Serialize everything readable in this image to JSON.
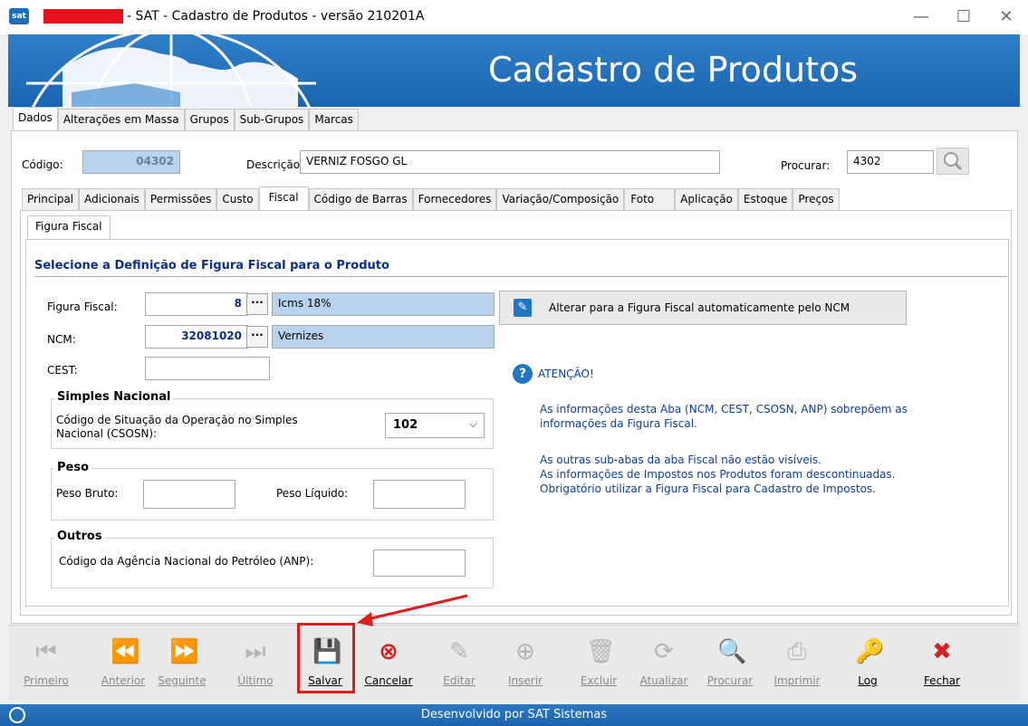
{
  "window": {
    "title": "- SAT - Cadastro de Produtos - versão 210201A",
    "app_icon": "sat",
    "minimize": "—",
    "maximize": "☐",
    "close": "✕"
  },
  "banner": {
    "title": "Cadastro de Produtos"
  },
  "main_tabs": [
    "Dados",
    "Alterações em Massa",
    "Grupos",
    "Sub-Grupos",
    "Marcas"
  ],
  "product": {
    "codigo_label": "Código:",
    "codigo_value": "04302",
    "descricao_label": "Descrição:",
    "descricao_value": "VERNIZ FOSGO GL",
    "procurar_label": "Procurar:",
    "procurar_value": "4302"
  },
  "sub_tabs": [
    "Principal",
    "Adicionais",
    "Permissões",
    "Custo",
    "Fiscal",
    "Código de Barras",
    "Fornecedores",
    "Variação/Composição",
    "Foto",
    "Aplicação",
    "Estoque",
    "Preços"
  ],
  "inner_tabs": [
    "Figura Fiscal"
  ],
  "fiscal": {
    "section_title": "Selecione a Definição de Figura Fiscal para o Produto",
    "figura_label": "Figura Fiscal:",
    "figura_code": "8",
    "figura_desc": "Icms 18%",
    "ncm_label": "NCM:",
    "ncm_code": "32081020",
    "ncm_desc": "Vernizes",
    "cest_label": "CEST:",
    "cest_value": "",
    "ellipsis": "···",
    "ncm_button": "Alterar para a Figura Fiscal automaticamente pelo NCM"
  },
  "simples": {
    "title": "Simples Nacional",
    "label_line1": "Código de Situação da Operação no Simples",
    "label_line2": "Nacional (CSOSN):",
    "csosn_value": "102"
  },
  "peso": {
    "title": "Peso",
    "bruto_label": "Peso Bruto:",
    "liquido_label": "Peso Líquido:"
  },
  "outros": {
    "title": "Outros",
    "anp_label": "Código da Agência Nacional do Petróleo (ANP):"
  },
  "notice": {
    "title": "ATENÇÃO!",
    "line1": "As informações desta Aba (NCM, CEST, CSOSN, ANP) sobrepõem as",
    "line2": "informações da Figura Fiscal.",
    "line3": "As outras sub-abas da aba Fiscal não estão visíveis.",
    "line4": "As informações de Impostos nos Produtos foram descontinuadas.",
    "line5": "Obrigatório utilizar a Figura Fiscal para Cadastro de Impostos."
  },
  "toolbar": [
    {
      "label": "Primeiro",
      "icon": "first-icon",
      "enabled": false
    },
    {
      "label": "Anterior",
      "icon": "previous-icon",
      "enabled": false
    },
    {
      "label": "Seguinte",
      "icon": "next-icon",
      "enabled": false
    },
    {
      "label": "Último",
      "icon": "last-icon",
      "enabled": false
    },
    {
      "label": "Salvar",
      "icon": "save-icon",
      "enabled": true
    },
    {
      "label": "Cancelar",
      "icon": "cancel-icon",
      "enabled": true
    },
    {
      "label": "Editar",
      "icon": "edit-icon",
      "enabled": false
    },
    {
      "label": "Inserir",
      "icon": "insert-icon",
      "enabled": false
    },
    {
      "label": "Excluir",
      "icon": "trash-icon",
      "enabled": false
    },
    {
      "label": "Atualizar",
      "icon": "refresh-icon",
      "enabled": false
    },
    {
      "label": "Procurar",
      "icon": "search-icon",
      "enabled": false
    },
    {
      "label": "Imprimir",
      "icon": "print-icon",
      "enabled": false
    },
    {
      "label": "Log",
      "icon": "key-icon",
      "enabled": true
    },
    {
      "label": "Fechar",
      "icon": "close-icon",
      "enabled": true
    }
  ],
  "status": {
    "text": "Desenvolvido por SAT Sistemas"
  },
  "colors": {
    "brand": "#1f6fbd",
    "highlight": "#e21b1b",
    "link": "#0b3f9c"
  }
}
